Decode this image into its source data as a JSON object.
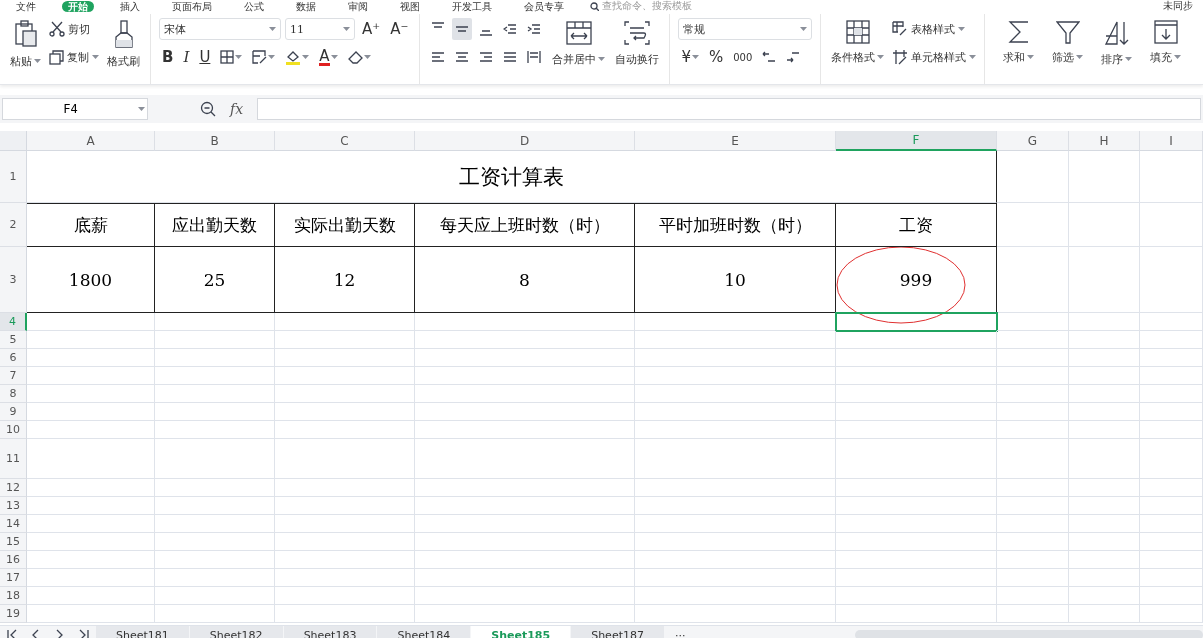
{
  "menu_tabs": [
    {
      "label": "文件",
      "selected": false
    },
    {
      "label": "开始",
      "selected": true
    },
    {
      "label": "插入",
      "selected": false
    },
    {
      "label": "页面布局",
      "selected": false
    },
    {
      "label": "公式",
      "selected": false
    },
    {
      "label": "数据",
      "selected": false
    },
    {
      "label": "审阅",
      "selected": false
    },
    {
      "label": "视图",
      "selected": false
    },
    {
      "label": "开发工具",
      "selected": false
    },
    {
      "label": "会员专享",
      "selected": false
    }
  ],
  "search": {
    "placeholder": "查找命令、搜索模板"
  },
  "sync_status": "未同步",
  "ribbon": {
    "paste": "粘贴",
    "cut": "剪切",
    "copy": "复制",
    "format_painter": "格式刷",
    "font_name": "宋体",
    "font_size": "11",
    "grow_font": "A⁺",
    "shrink_font": "A⁻",
    "bold": "B",
    "italic": "I",
    "underline": "U",
    "font_color": "A",
    "vertical_align": [
      {
        "selected": false
      },
      {
        "selected": true
      },
      {
        "selected": false
      }
    ],
    "merge_center": "合并居中",
    "wrap_text": "自动换行",
    "number_format": "常规",
    "currency": "¥",
    "percent": "%",
    "thousands": "000",
    "conditional_format": "条件格式",
    "table_style": "表格样式",
    "cell_style": "单元格样式",
    "sum": "求和",
    "filter": "筛选",
    "sort": "排序",
    "fill": "填充"
  },
  "formula_bar": {
    "name_box": "F4",
    "fx": "fx"
  },
  "columns": [
    {
      "label": "A",
      "selected": false
    },
    {
      "label": "B",
      "selected": false
    },
    {
      "label": "C",
      "selected": false
    },
    {
      "label": "D",
      "selected": false
    },
    {
      "label": "E",
      "selected": false
    },
    {
      "label": "F",
      "selected": true
    },
    {
      "label": "G",
      "selected": false
    },
    {
      "label": "H",
      "selected": false
    },
    {
      "label": "I",
      "selected": false
    }
  ],
  "rows": [
    {
      "label": "1",
      "selected": false,
      "kind": "title",
      "title": "工资计算表"
    },
    {
      "label": "2",
      "selected": false,
      "kind": "table",
      "cells": [
        {
          "text": "底薪",
          "circled": false
        },
        {
          "text": "应出勤天数",
          "circled": false
        },
        {
          "text": "实际出勤天数",
          "circled": false
        },
        {
          "text": "每天应上班时数（时）",
          "circled": false
        },
        {
          "text": "平时加班时数（时）",
          "circled": false
        },
        {
          "text": "工资",
          "circled": false
        }
      ]
    },
    {
      "label": "3",
      "selected": false,
      "kind": "table",
      "cells": [
        {
          "text": "1800",
          "circled": false
        },
        {
          "text": "25",
          "circled": false
        },
        {
          "text": "12",
          "circled": false
        },
        {
          "text": "8",
          "circled": false
        },
        {
          "text": "10",
          "circled": false
        },
        {
          "text": "999",
          "circled": true
        }
      ]
    },
    {
      "label": "4",
      "selected": true,
      "kind": "empty"
    },
    {
      "label": "5",
      "selected": false,
      "kind": "empty"
    },
    {
      "label": "6",
      "selected": false,
      "kind": "empty"
    },
    {
      "label": "7",
      "selected": false,
      "kind": "empty"
    },
    {
      "label": "8",
      "selected": false,
      "kind": "empty"
    },
    {
      "label": "9",
      "selected": false,
      "kind": "empty"
    },
    {
      "label": "10",
      "selected": false,
      "kind": "empty"
    },
    {
      "label": "11",
      "selected": false,
      "kind": "empty"
    },
    {
      "label": "12",
      "selected": false,
      "kind": "empty"
    },
    {
      "label": "13",
      "selected": false,
      "kind": "empty"
    },
    {
      "label": "14",
      "selected": false,
      "kind": "empty"
    },
    {
      "label": "15",
      "selected": false,
      "kind": "empty"
    },
    {
      "label": "16",
      "selected": false,
      "kind": "empty"
    },
    {
      "label": "17",
      "selected": false,
      "kind": "empty"
    },
    {
      "label": "18",
      "selected": false,
      "kind": "empty"
    },
    {
      "label": "19",
      "selected": false,
      "kind": "empty"
    }
  ],
  "sheet_tabs": [
    {
      "label": "Sheet181",
      "selected": false
    },
    {
      "label": "Sheet182",
      "selected": false
    },
    {
      "label": "Sheet183",
      "selected": false
    },
    {
      "label": "Sheet184",
      "selected": false
    },
    {
      "label": "Sheet185",
      "selected": true
    },
    {
      "label": "Sheet187",
      "selected": false
    }
  ],
  "more_tabs": "···"
}
